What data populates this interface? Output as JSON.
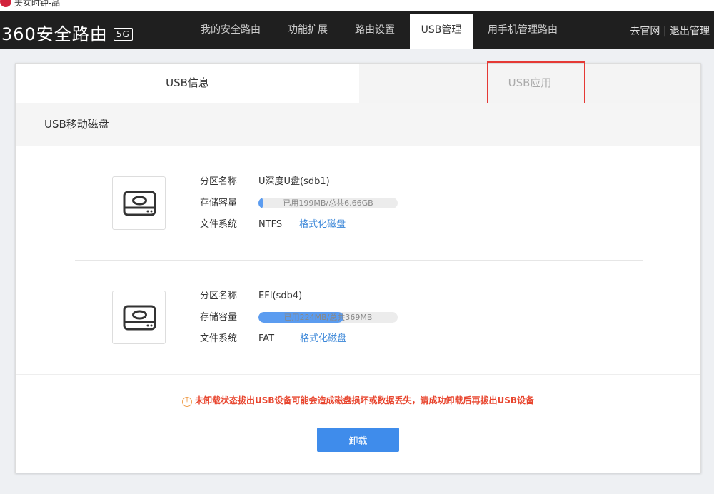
{
  "window": {
    "title": "美女时钟-品"
  },
  "nav": {
    "brand": "360安全路由",
    "brand_badge": "5G",
    "items": [
      {
        "label": "我的安全路由"
      },
      {
        "label": "功能扩展"
      },
      {
        "label": "路由设置"
      },
      {
        "label": "USB管理"
      },
      {
        "label": "用手机管理路由"
      }
    ],
    "active": "USB管理",
    "right_links": [
      "去官网",
      "退出管理"
    ]
  },
  "tabs": [
    {
      "label": "USB信息",
      "active": true
    },
    {
      "label": "USB应用",
      "active": false,
      "highlighted": true
    }
  ],
  "section_title": "USB移动磁盘",
  "labels": {
    "name": "分区名称",
    "capacity": "存储容量",
    "fs": "文件系统",
    "format": "格式化磁盘"
  },
  "disks": [
    {
      "name": "U深度U盘(sdb1)",
      "usage_text": "已用199MB/总共6.66GB",
      "used_fraction": 0.03,
      "fs": "NTFS"
    },
    {
      "name": "EFI(sdb4)",
      "usage_text": "已用224MB/总共369MB",
      "used_fraction": 0.61,
      "fs": "FAT"
    }
  ],
  "warning": "未卸载状态拔出USB设备可能会造成磁盘损坏或数据丢失，请成功卸载后再拔出USB设备",
  "unmount_button": "卸载",
  "colors": {
    "accent": "#3f8ceb",
    "warning": "#e8462f",
    "nav_bg": "#1f1f1f"
  }
}
